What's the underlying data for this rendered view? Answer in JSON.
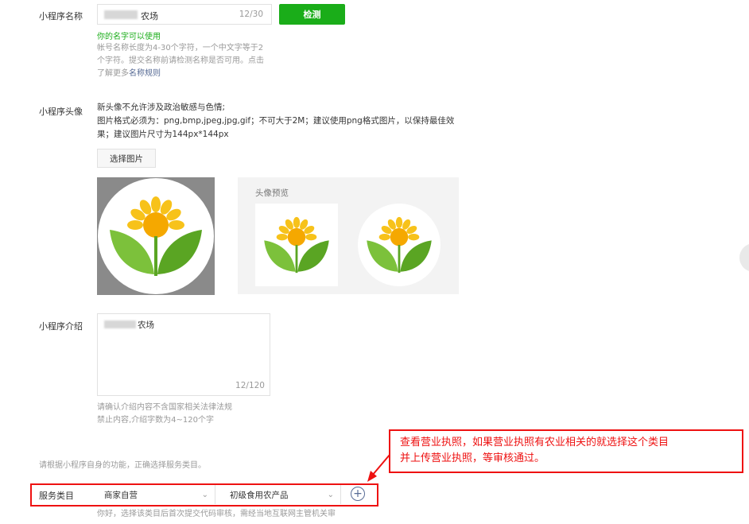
{
  "name_section": {
    "label": "小程序名称",
    "input_value": "农场",
    "counter": "12/30",
    "check_button": "检测",
    "ok_message": "你的名字可以使用",
    "hint_line1": "帐号名称长度为4-30个字符，一个中文字等于2",
    "hint_line2": "个字符。提交名称前请检测名称是否可用。点击",
    "hint_line3_prefix": "了解更多",
    "hint_link": "名称规则"
  },
  "avatar_section": {
    "label": "小程序头像",
    "rule_line1": "新头像不允许涉及政治敏感与色情;",
    "rule_line2": "图片格式必须为：png,bmp,jpeg,jpg,gif；不可大于2M；建议使用png格式图片，以保持最佳效",
    "rule_line3": "果；建议图片尺寸为144px*144px",
    "pick_button": "选择图片",
    "preview_title": "头像预览"
  },
  "intro_section": {
    "label": "小程序介绍",
    "text_value": "农场",
    "counter": "12/120",
    "hint_line1": "请确认介绍内容不含国家相关法律法规",
    "hint_line2": "禁止内容,介绍字数为4~120个字"
  },
  "category_section": {
    "intro_text": "请根据小程序自身的功能，正确选择服务类目。",
    "label": "服务类目",
    "primary_value": "商家自营",
    "secondary_value": "初级食用农产品",
    "footer_text": "你好，选择该类目后首次提交代码审核，需经当地互联网主管机关审"
  },
  "annotation": {
    "line1": "查看营业执照，如果营业执照有农业相关的就选择这个类目",
    "line2": "并上传营业执照，等审核通过。"
  },
  "colors": {
    "primary_green": "#1aad19",
    "annotation_red": "#ee1111",
    "link_blue": "#576b95"
  },
  "icons": [
    "chevron-down-icon",
    "add-circle-icon",
    "sunflower-logo",
    "red-arrow"
  ]
}
